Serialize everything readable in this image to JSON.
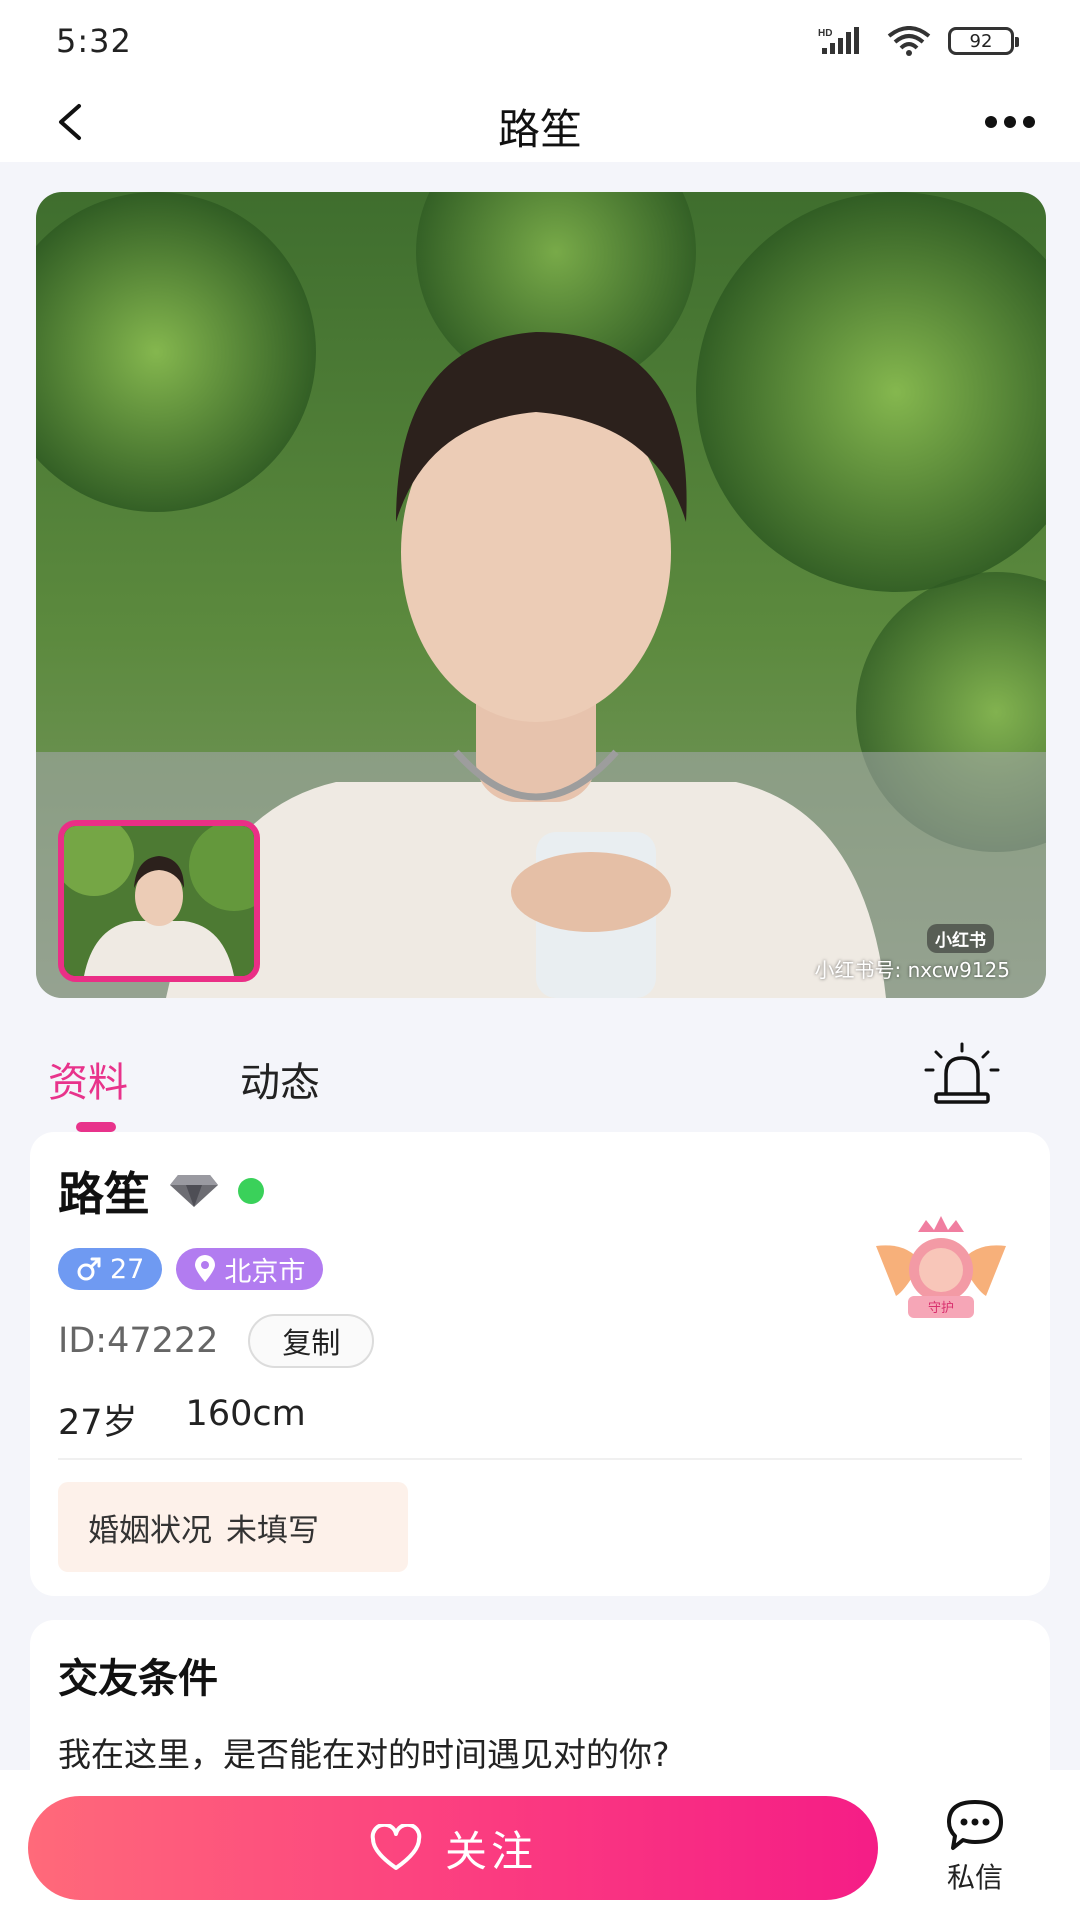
{
  "status_bar": {
    "time": "5:32",
    "battery": "92",
    "network_label": "HD"
  },
  "nav": {
    "title": "路笙"
  },
  "photo": {
    "watermark": "小红书号: nxcw9125",
    "watermark_badge": "小红书"
  },
  "tabs": [
    {
      "label": "资料",
      "active": true
    },
    {
      "label": "动态",
      "active": false
    }
  ],
  "profile": {
    "name": "路笙",
    "gender_age": "27",
    "location": "北京市",
    "id_text": "ID:47222",
    "copy_label": "复制",
    "age_text": "27岁",
    "height_text": "160cm",
    "marital_label": "婚姻状况",
    "marital_value": "未填写",
    "guard_label": "守护"
  },
  "conditions": {
    "title": "交友条件",
    "text": "我在这里，是否能在对的时间遇见对的你?"
  },
  "bottom": {
    "follow_label": "关注",
    "dm_label": "私信"
  },
  "colors": {
    "accent": "#e8338b",
    "online": "#3ad15a",
    "gender_badge": "#6f9af2",
    "location_badge": "#b27cf0"
  }
}
